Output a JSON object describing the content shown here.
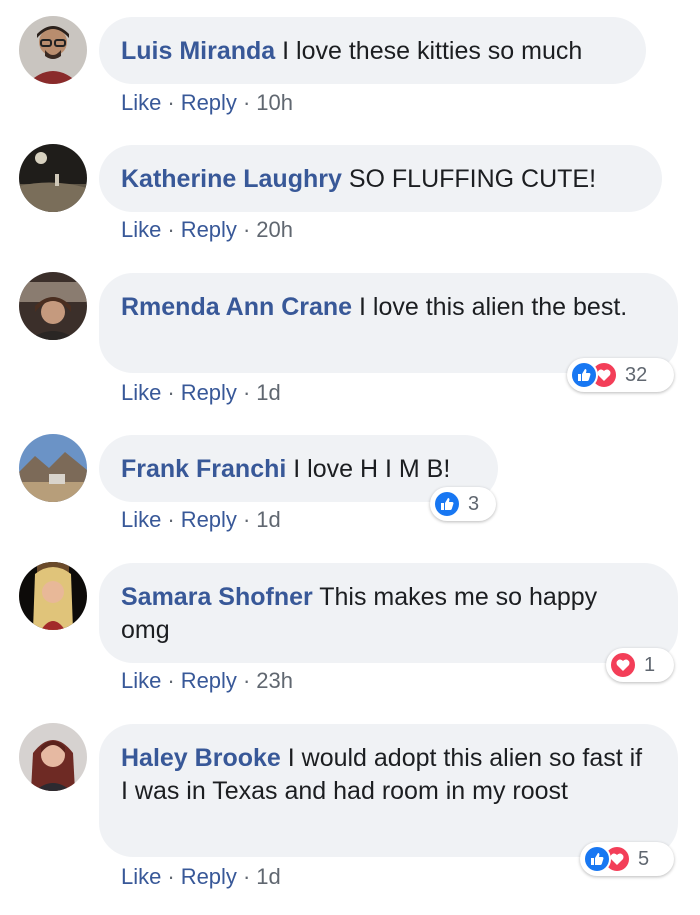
{
  "labels": {
    "like": "Like",
    "reply": "Reply",
    "separator": "·"
  },
  "colors": {
    "author": "#385898",
    "bubble": "#f0f2f5",
    "like": "#1877f2",
    "love": "#f33e58"
  },
  "comments": [
    {
      "author": "Luis Miranda",
      "text": "I love these kitties so much",
      "time": "10h",
      "avatar_icon": "man-glasses-avatar"
    },
    {
      "author": "Katherine Laughry",
      "text": "SO FLUFFING CUTE!",
      "time": "20h",
      "avatar_icon": "night-field-avatar"
    },
    {
      "author": "Rmenda Ann Crane",
      "text": "I love this alien the best.",
      "time": "1d",
      "avatar_icon": "woman-car-avatar",
      "reactions": {
        "types": [
          "like-icon",
          "love-icon"
        ],
        "count": "32"
      }
    },
    {
      "author": "Frank Franchi",
      "text": "I love H I M B!",
      "time": "1d",
      "avatar_icon": "mountain-landscape-avatar",
      "reactions": {
        "types": [
          "like-icon"
        ],
        "count": "3"
      }
    },
    {
      "author": "Samara Shofner",
      "text": "This makes me so happy omg",
      "time": "23h",
      "avatar_icon": "blonde-woman-avatar",
      "reactions": {
        "types": [
          "love-icon"
        ],
        "count": "1"
      }
    },
    {
      "author": "Haley Brooke",
      "text": "I would adopt this alien so fast if I was in Texas and had room in my roost",
      "time": "1d",
      "avatar_icon": "red-hair-woman-avatar",
      "reactions": {
        "types": [
          "like-icon",
          "love-icon"
        ],
        "count": "5"
      }
    }
  ]
}
